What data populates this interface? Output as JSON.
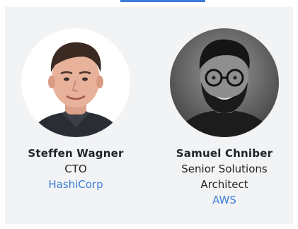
{
  "colors": {
    "panel_bg": "#f2f3f5",
    "link": "#3b7dd8",
    "accent": "#3b7dd8"
  },
  "speakers": [
    {
      "name": "Steffen Wagner",
      "role": "CTO",
      "company": "HashiCorp",
      "photo_icon": "person-photo"
    },
    {
      "name": "Samuel Chniber",
      "role_line1": "Senior Solutions",
      "role_line2": "Architect",
      "company": "AWS",
      "photo_icon": "person-photo"
    }
  ]
}
